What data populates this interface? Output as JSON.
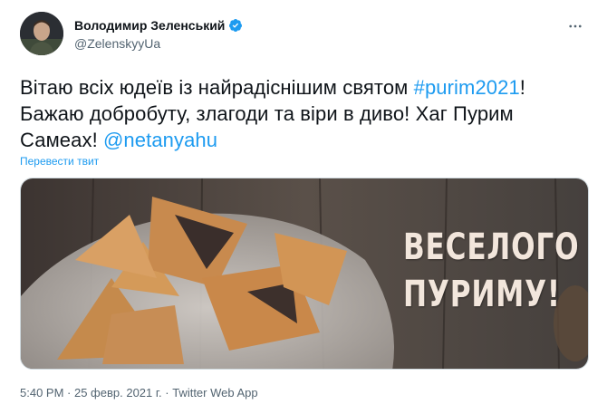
{
  "author": {
    "name": "Володимир Зеленський",
    "handle": "@ZelenskyyUa",
    "verified": true
  },
  "tweet": {
    "text_before": "Вітаю всіх юдеїв із найрадіснішим святом ",
    "hashtag": "#purim2021",
    "text_after": "! Бажаю добробуту, злагоди та віри в диво! Хаг Пурим Самеах! ",
    "mention": "@netanyahu",
    "translate_label": "Перевести твит"
  },
  "media": {
    "caption_line1": "ВЕСЕЛОГО",
    "caption_line2": "ПУРИМУ!"
  },
  "meta": {
    "time": "5:40 PM",
    "sep1": " · ",
    "date": "25 февр. 2021 г.",
    "sep2": " · ",
    "source": "Twitter Web App"
  },
  "icons": {
    "verified": "verified-badge-icon",
    "more": "more-dots-icon"
  },
  "colors": {
    "link": "#1d9bf0",
    "secondary": "#536471",
    "text": "#0f1419"
  }
}
